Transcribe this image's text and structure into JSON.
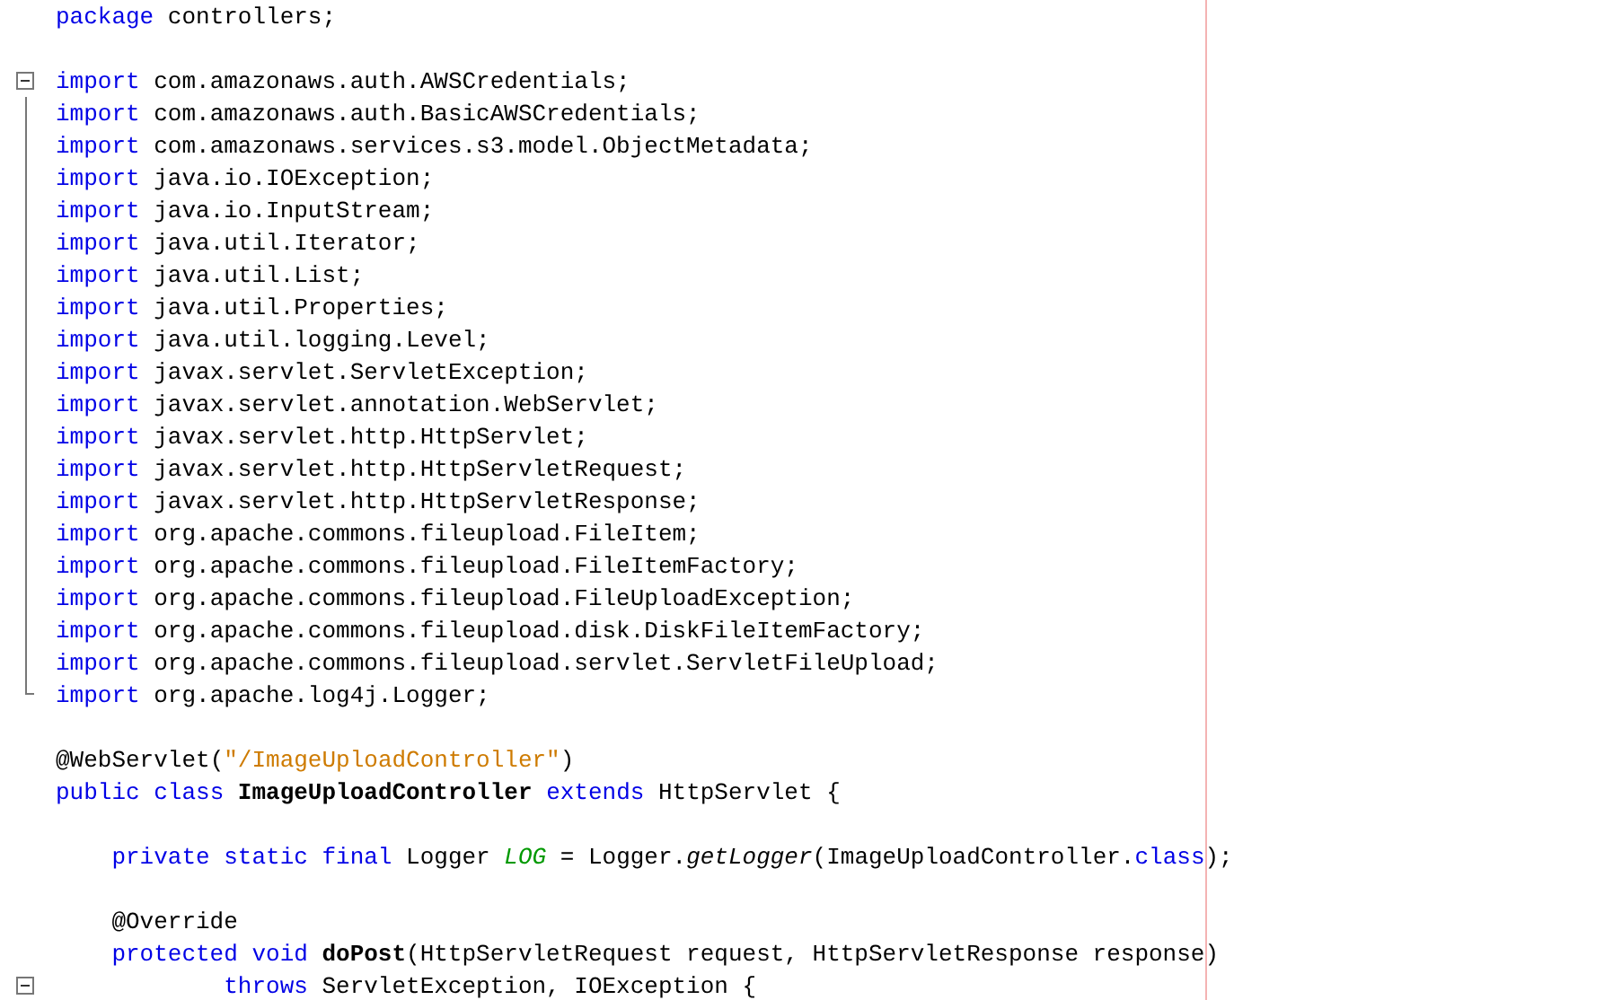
{
  "editor": {
    "lines": [
      {
        "kind": "code",
        "tokens": [
          {
            "kind": "keyword",
            "text": "package"
          },
          {
            "kind": "plain",
            "text": " controllers;"
          }
        ]
      },
      {
        "kind": "blank"
      },
      {
        "kind": "code",
        "fold_toggle": {
          "expanded": true
        },
        "tokens": [
          {
            "kind": "keyword",
            "text": "import"
          },
          {
            "kind": "plain",
            "text": " com.amazonaws.auth.AWSCredentials;"
          }
        ]
      },
      {
        "kind": "code",
        "in_fold": true,
        "tokens": [
          {
            "kind": "keyword",
            "text": "import"
          },
          {
            "kind": "plain",
            "text": " com.amazonaws.auth.BasicAWSCredentials;"
          }
        ]
      },
      {
        "kind": "code",
        "in_fold": true,
        "tokens": [
          {
            "kind": "keyword",
            "text": "import"
          },
          {
            "kind": "plain",
            "text": " com.amazonaws.services.s3.model.ObjectMetadata;"
          }
        ]
      },
      {
        "kind": "code",
        "in_fold": true,
        "tokens": [
          {
            "kind": "keyword",
            "text": "import"
          },
          {
            "kind": "plain",
            "text": " java.io.IOException;"
          }
        ]
      },
      {
        "kind": "code",
        "in_fold": true,
        "tokens": [
          {
            "kind": "keyword",
            "text": "import"
          },
          {
            "kind": "plain",
            "text": " java.io.InputStream;"
          }
        ]
      },
      {
        "kind": "code",
        "in_fold": true,
        "tokens": [
          {
            "kind": "keyword",
            "text": "import"
          },
          {
            "kind": "plain",
            "text": " java.util.Iterator;"
          }
        ]
      },
      {
        "kind": "code",
        "in_fold": true,
        "tokens": [
          {
            "kind": "keyword",
            "text": "import"
          },
          {
            "kind": "plain",
            "text": " java.util.List;"
          }
        ]
      },
      {
        "kind": "code",
        "in_fold": true,
        "tokens": [
          {
            "kind": "keyword",
            "text": "import"
          },
          {
            "kind": "plain",
            "text": " java.util.Properties;"
          }
        ]
      },
      {
        "kind": "code",
        "in_fold": true,
        "tokens": [
          {
            "kind": "keyword",
            "text": "import"
          },
          {
            "kind": "plain",
            "text": " java.util.logging.Level;"
          }
        ]
      },
      {
        "kind": "code",
        "in_fold": true,
        "tokens": [
          {
            "kind": "keyword",
            "text": "import"
          },
          {
            "kind": "plain",
            "text": " javax.servlet.ServletException;"
          }
        ]
      },
      {
        "kind": "code",
        "in_fold": true,
        "tokens": [
          {
            "kind": "keyword",
            "text": "import"
          },
          {
            "kind": "plain",
            "text": " javax.servlet.annotation.WebServlet;"
          }
        ]
      },
      {
        "kind": "code",
        "in_fold": true,
        "tokens": [
          {
            "kind": "keyword",
            "text": "import"
          },
          {
            "kind": "plain",
            "text": " javax.servlet.http.HttpServlet;"
          }
        ]
      },
      {
        "kind": "code",
        "in_fold": true,
        "tokens": [
          {
            "kind": "keyword",
            "text": "import"
          },
          {
            "kind": "plain",
            "text": " javax.servlet.http.HttpServletRequest;"
          }
        ]
      },
      {
        "kind": "code",
        "in_fold": true,
        "tokens": [
          {
            "kind": "keyword",
            "text": "import"
          },
          {
            "kind": "plain",
            "text": " javax.servlet.http.HttpServletResponse;"
          }
        ]
      },
      {
        "kind": "code",
        "in_fold": true,
        "tokens": [
          {
            "kind": "keyword",
            "text": "import"
          },
          {
            "kind": "plain",
            "text": " org.apache.commons.fileupload.FileItem;"
          }
        ]
      },
      {
        "kind": "code",
        "in_fold": true,
        "tokens": [
          {
            "kind": "keyword",
            "text": "import"
          },
          {
            "kind": "plain",
            "text": " org.apache.commons.fileupload.FileItemFactory;"
          }
        ]
      },
      {
        "kind": "code",
        "in_fold": true,
        "tokens": [
          {
            "kind": "keyword",
            "text": "import"
          },
          {
            "kind": "plain",
            "text": " org.apache.commons.fileupload.FileUploadException;"
          }
        ]
      },
      {
        "kind": "code",
        "in_fold": true,
        "tokens": [
          {
            "kind": "keyword",
            "text": "import"
          },
          {
            "kind": "plain",
            "text": " org.apache.commons.fileupload.disk.DiskFileItemFactory;"
          }
        ]
      },
      {
        "kind": "code",
        "in_fold": true,
        "tokens": [
          {
            "kind": "keyword",
            "text": "import"
          },
          {
            "kind": "plain",
            "text": " org.apache.commons.fileupload.servlet.ServletFileUpload;"
          }
        ]
      },
      {
        "kind": "code",
        "fold_end": true,
        "tokens": [
          {
            "kind": "keyword",
            "text": "import"
          },
          {
            "kind": "plain",
            "text": " org.apache.log4j.Logger;"
          }
        ]
      },
      {
        "kind": "blank"
      },
      {
        "kind": "code",
        "tokens": [
          {
            "kind": "plain",
            "text": "@WebServlet("
          },
          {
            "kind": "string",
            "text": "\"/ImageUploadController\""
          },
          {
            "kind": "plain",
            "text": ")"
          }
        ]
      },
      {
        "kind": "code",
        "tokens": [
          {
            "kind": "keyword",
            "text": "public class"
          },
          {
            "kind": "declaration",
            "text": " ImageUploadController "
          },
          {
            "kind": "keyword",
            "text": "extends"
          },
          {
            "kind": "plain",
            "text": " HttpServlet {"
          }
        ],
        "children": [
          {
            "kind": "blank"
          },
          {
            "kind": "code",
            "tokens": [
              {
                "kind": "keyword",
                "text": "private static final"
              },
              {
                "kind": "plain",
                "text": " Logger "
              },
              {
                "kind": "field",
                "text": "LOG"
              },
              {
                "kind": "plain",
                "text": " = Logger."
              },
              {
                "kind": "method",
                "text": "getLogger"
              },
              {
                "kind": "plain",
                "text": "(ImageUploadController."
              },
              {
                "kind": "keyword",
                "text": "class"
              },
              {
                "kind": "plain",
                "text": ");"
              }
            ]
          },
          {
            "kind": "blank"
          },
          {
            "kind": "code",
            "tokens": [
              {
                "kind": "plain",
                "text": "@Override"
              }
            ]
          },
          {
            "kind": "code",
            "tokens": [
              {
                "kind": "keyword",
                "text": "protected void"
              },
              {
                "kind": "declaration",
                "text": " doPost"
              },
              {
                "kind": "plain",
                "text": "(HttpServletRequest request, HttpServletResponse response)"
              }
            ],
            "children": [
              {
                "kind": "continuation",
                "fold_toggle": {
                  "expanded": true
                },
                "tokens": [
                  {
                    "kind": "keyword",
                    "text": "throws"
                  },
                  {
                    "kind": "plain",
                    "text": " ServletException, IOException {"
                  }
                ]
              }
            ]
          }
        ]
      }
    ]
  }
}
